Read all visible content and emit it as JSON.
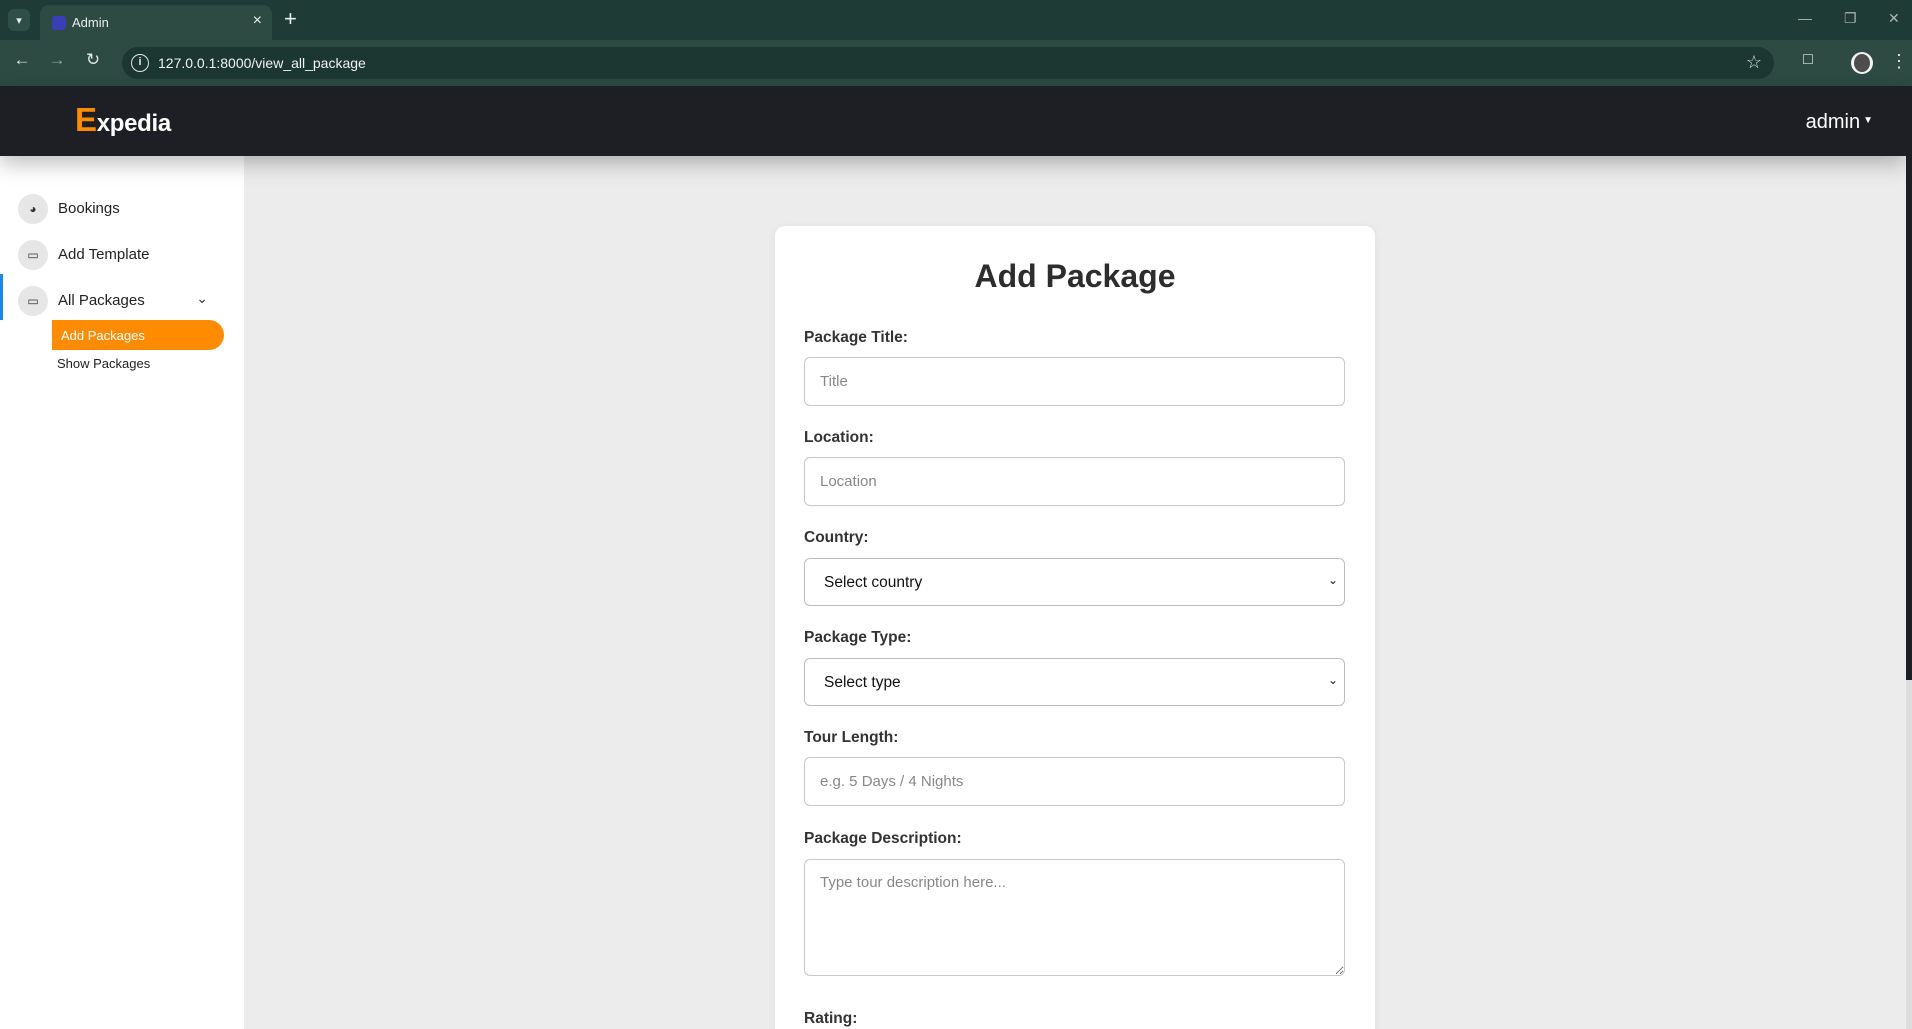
{
  "browser": {
    "tab_title": "Admin",
    "url": "127.0.0.1:8000/view_all_package"
  },
  "header": {
    "logo_first": "E",
    "logo_rest": "xpedia",
    "user_label": "admin"
  },
  "sidebar": {
    "items": [
      {
        "label": "Bookings",
        "icon": "gauge-icon"
      },
      {
        "label": "Add Template",
        "icon": "laptop-icon"
      },
      {
        "label": "All Packages",
        "icon": "laptop-icon"
      }
    ],
    "sub_items": [
      {
        "label": "Add Packages",
        "active": true
      },
      {
        "label": "Show Packages",
        "active": false
      }
    ]
  },
  "form": {
    "title": "Add Package",
    "package_title": {
      "label": "Package Title:",
      "placeholder": "Title"
    },
    "location": {
      "label": "Location:",
      "placeholder": "Location"
    },
    "country": {
      "label": "Country:",
      "selected": "Select country"
    },
    "package_type": {
      "label": "Package Type:",
      "selected": "Select type"
    },
    "tour_length": {
      "label": "Tour Length:",
      "placeholder": "e.g. 5 Days / 4 Nights"
    },
    "description": {
      "label": "Package Description:",
      "placeholder": "Type tour description here..."
    },
    "rating": {
      "label": "Rating:"
    }
  },
  "colors": {
    "accent": "#ff8c00",
    "header_bg": "#1d1f25",
    "active_indicator": "#1e88e5"
  }
}
